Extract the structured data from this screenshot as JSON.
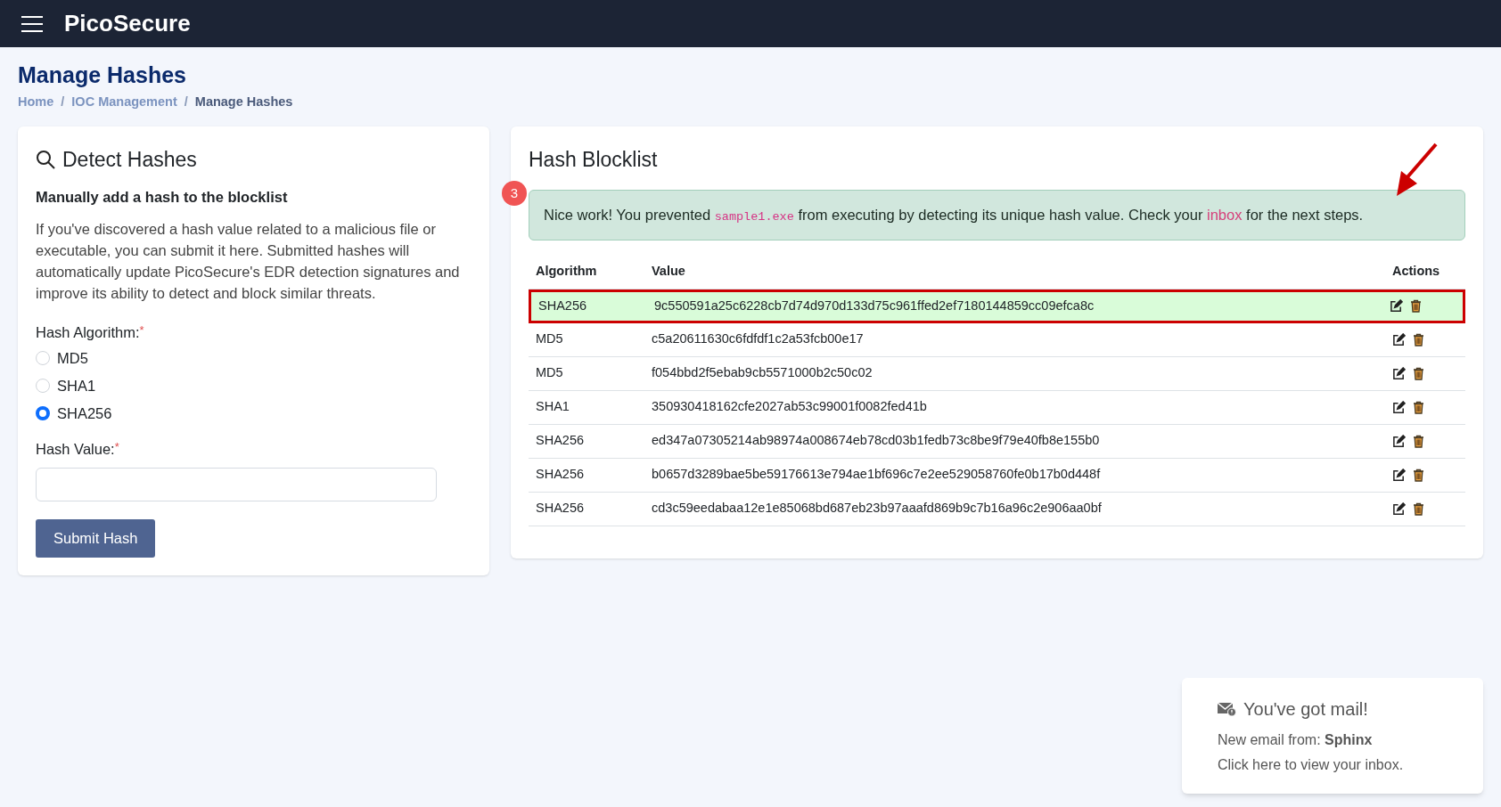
{
  "header": {
    "brand": "PicoSecure"
  },
  "page": {
    "title": "Manage Hashes",
    "breadcrumb_separator": "/",
    "breadcrumb": [
      {
        "label": "Home",
        "current": false
      },
      {
        "label": "IOC Management",
        "current": false
      },
      {
        "label": "Manage Hashes",
        "current": true
      }
    ]
  },
  "detect_card": {
    "title": "Detect Hashes",
    "subtitle": "Manually add a hash to the blocklist",
    "description": "If you've discovered a hash value related to a malicious file or executable, you can submit it here. Submitted hashes will automatically update PicoSecure's EDR detection signatures and improve its ability to detect and block similar threats.",
    "algorithm_label": "Hash Algorithm:",
    "required_mark": "*",
    "algorithms": [
      {
        "label": "MD5",
        "selected": false
      },
      {
        "label": "SHA1",
        "selected": false
      },
      {
        "label": "SHA256",
        "selected": true
      }
    ],
    "value_label": "Hash Value:",
    "submit": "Submit Hash"
  },
  "blocklist_card": {
    "title": "Hash Blocklist",
    "step_badge": "3",
    "alert": {
      "before": "Nice work! You prevented ",
      "code": "sample1.exe",
      "middle": " from executing by detecting its unique hash value. Check your ",
      "link": "inbox",
      "after": " for the next steps."
    },
    "columns": [
      "Algorithm",
      "Value",
      "Actions"
    ],
    "rows": [
      {
        "algorithm": "SHA256",
        "value": "9c550591a25c6228cb7d74d970d133d75c961ffed2ef7180144859cc09efca8c",
        "highlighted": true
      },
      {
        "algorithm": "MD5",
        "value": "c5a20611630c6fdfdf1c2a53fcb00e17",
        "highlighted": false
      },
      {
        "algorithm": "MD5",
        "value": "f054bbd2f5ebab9cb5571000b2c50c02",
        "highlighted": false
      },
      {
        "algorithm": "SHA1",
        "value": "350930418162cfe2027ab53c99001f0082fed41b",
        "highlighted": false
      },
      {
        "algorithm": "SHA256",
        "value": "ed347a07305214ab98974a008674eb78cd03b1fedb73c8be9f79e40fb8e155b0",
        "highlighted": false
      },
      {
        "algorithm": "SHA256",
        "value": "b0657d3289bae5be59176613e794ae1bf696c7e2ee529058760fe0b17b0d448f",
        "highlighted": false
      },
      {
        "algorithm": "SHA256",
        "value": "cd3c59eedabaa12e1e85068bd687eb23b97aaafd869b9c7b16a96c2e906aa0bf",
        "highlighted": false
      }
    ]
  },
  "toast": {
    "title": "You've got mail!",
    "from_label": "New email from: ",
    "sender": "Sphinx",
    "hint": "Click here to view your inbox."
  }
}
